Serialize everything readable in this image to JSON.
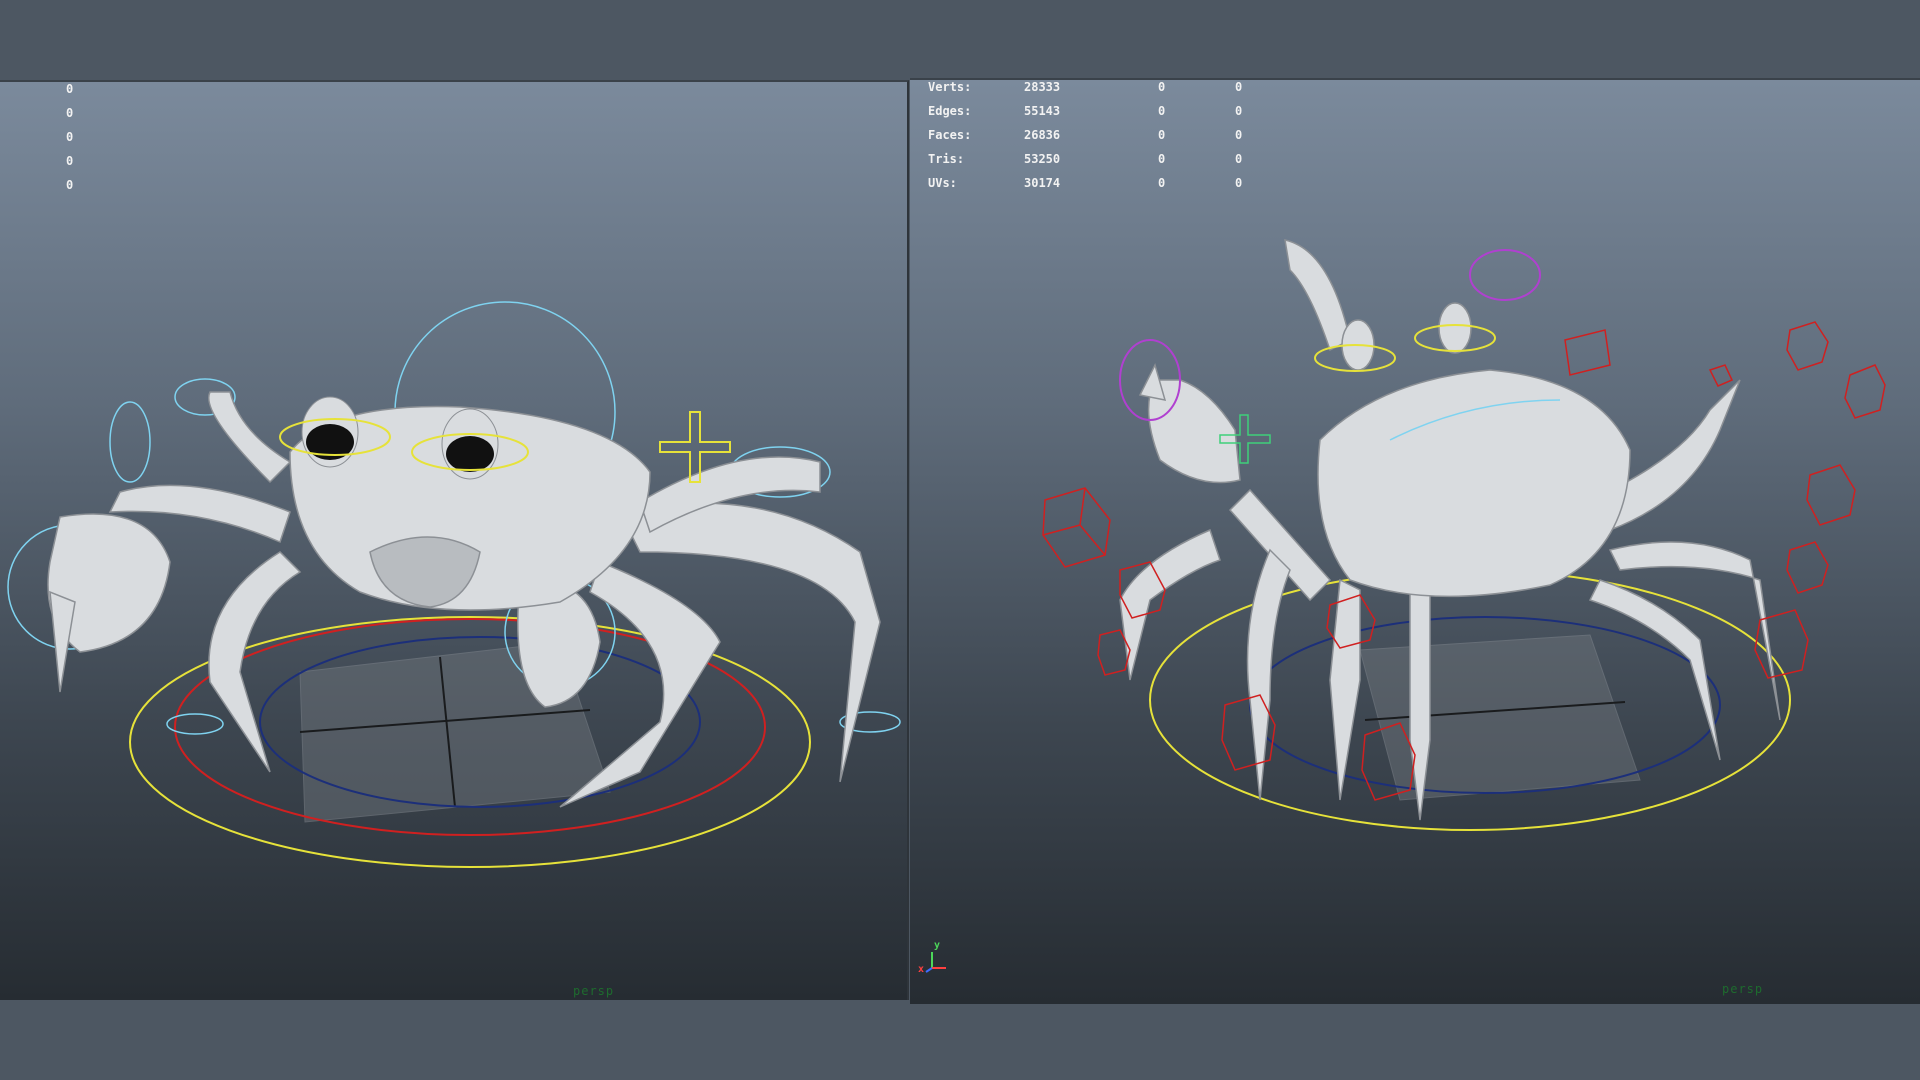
{
  "left_viewport": {
    "hud_values": [
      "0",
      "0",
      "0",
      "0",
      "0"
    ],
    "camera_label": "persp"
  },
  "right_viewport": {
    "hud": [
      {
        "label": "Verts:",
        "total": "28333",
        "selected": "0",
        "extra": "0"
      },
      {
        "label": "Edges:",
        "total": "55143",
        "selected": "0",
        "extra": "0"
      },
      {
        "label": "Faces:",
        "total": "26836",
        "selected": "0",
        "extra": "0"
      },
      {
        "label": "Tris:",
        "total": "53250",
        "selected": "0",
        "extra": "0"
      },
      {
        "label": "UVs:",
        "total": "30174",
        "selected": "0",
        "extra": "0"
      }
    ],
    "camera_label": "persp",
    "axis": {
      "y": "y",
      "x": "x"
    }
  },
  "colors": {
    "rig_cyan": "#7fd3f0",
    "rig_yellow": "#e6e23a",
    "rig_red": "#d02020",
    "rig_blue": "#1c2f7a",
    "rig_magenta": "#b040d0",
    "model": "#d9dcdf"
  }
}
